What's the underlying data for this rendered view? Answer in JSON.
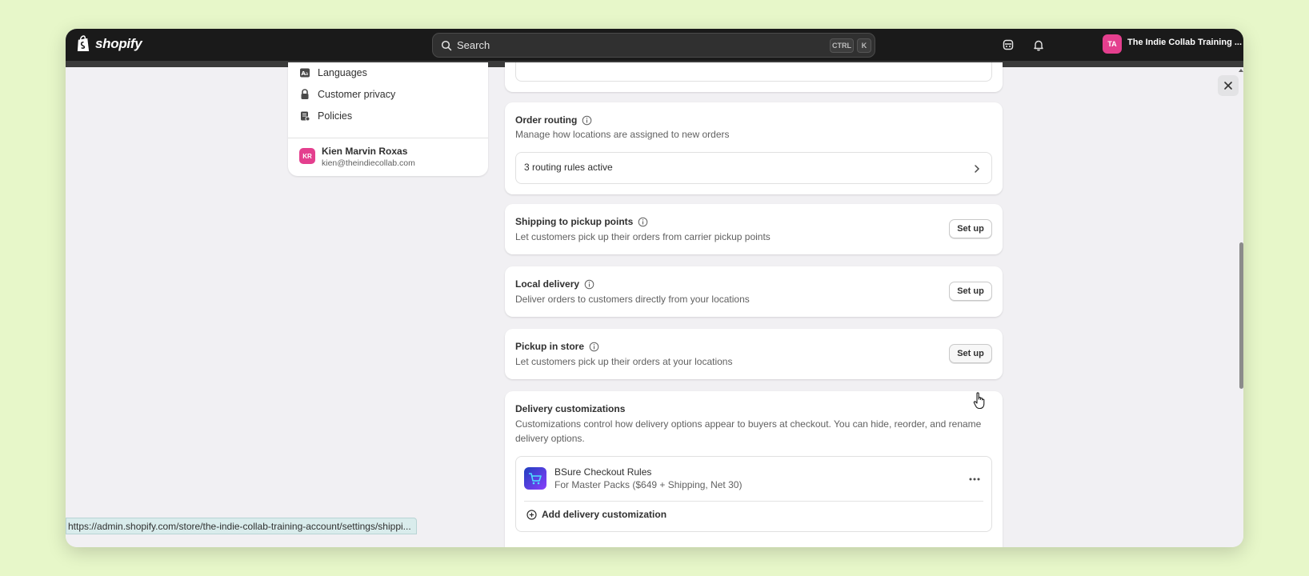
{
  "app": {
    "logo_text": "shopify"
  },
  "topbar": {
    "search_placeholder": "Search",
    "shortcut_ctrl": "CTRL",
    "shortcut_k": "K",
    "store_initials": "TA",
    "store_name": "The Indie Collab Training ..."
  },
  "sidebar": {
    "items": [
      {
        "label": "Languages",
        "icon": "languages-icon"
      },
      {
        "label": "Customer privacy",
        "icon": "lock-icon"
      },
      {
        "label": "Policies",
        "icon": "policies-icon"
      }
    ],
    "user": {
      "initials": "KR",
      "name": "Kien Marvin Roxas",
      "email": "kien@theindiecollab.com"
    }
  },
  "main": {
    "order_routing": {
      "title": "Order routing",
      "description": "Manage how locations are assigned to new orders",
      "rules_label": "3 routing rules active"
    },
    "pickup_points": {
      "title": "Shipping to pickup points",
      "description": "Let customers pick up their orders from carrier pickup points",
      "button": "Set up"
    },
    "local_delivery": {
      "title": "Local delivery",
      "description": "Deliver orders to customers directly from your locations",
      "button": "Set up"
    },
    "pickup_in_store": {
      "title": "Pickup in store",
      "description": "Let customers pick up their orders at your locations",
      "button": "Set up"
    },
    "delivery_customizations": {
      "title": "Delivery customizations",
      "description": "Customizations control how delivery options appear to buyers at checkout. You can hide, reorder, and rename delivery options.",
      "app_name": "BSure Checkout Rules",
      "app_subtitle": "For Master Packs ($649 + Shipping, Net 30)",
      "add_label": "Add delivery customization"
    }
  },
  "status_bar": {
    "url": "https://admin.shopify.com/store/the-indie-collab-training-account/settings/shippi..."
  },
  "colors": {
    "accent": "#e43f8e",
    "topbar": "#1a1a1a",
    "background": "#f1f0f3"
  }
}
